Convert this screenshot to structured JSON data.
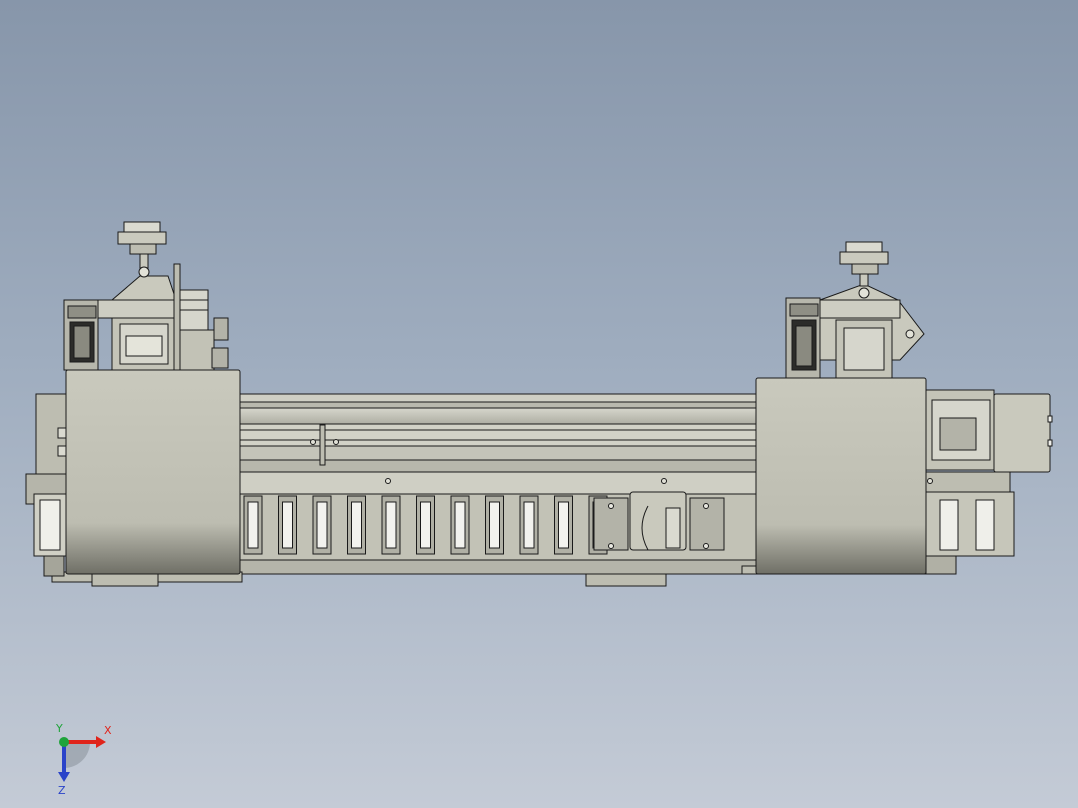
{
  "colors": {
    "background_top": "#8796aa",
    "background_bottom": "#c4cbd6",
    "part_fill": "#c9c9bd",
    "part_light": "#dcdcd2",
    "part_dark": "#9e9e92",
    "edge": "#1a1a1a",
    "axis_x": "#e0241b",
    "axis_y": "#1fa33a",
    "axis_z": "#2a43c9"
  },
  "triad": {
    "x_label": "X",
    "y_label": "Y",
    "z_label": "Z"
  },
  "icons": {
    "triad": "coordinate-triad-icon"
  }
}
